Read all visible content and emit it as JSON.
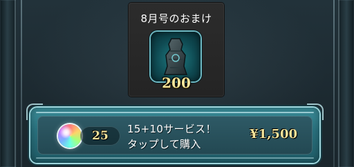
{
  "bonus": {
    "title": "8月号のおまけ",
    "item_icon": "dark-statue-icon",
    "item_count": "200"
  },
  "purchase": {
    "orb_icon": "rainbow-orb-icon",
    "orb_count": "25",
    "offer_line1": "15+10サービス！",
    "offer_line2": "タップして購入",
    "price": "¥1,500"
  },
  "colors": {
    "gold_text": "#f3e39a",
    "bar_teal": "#2a7380",
    "frame_light": "#9fd7de"
  }
}
